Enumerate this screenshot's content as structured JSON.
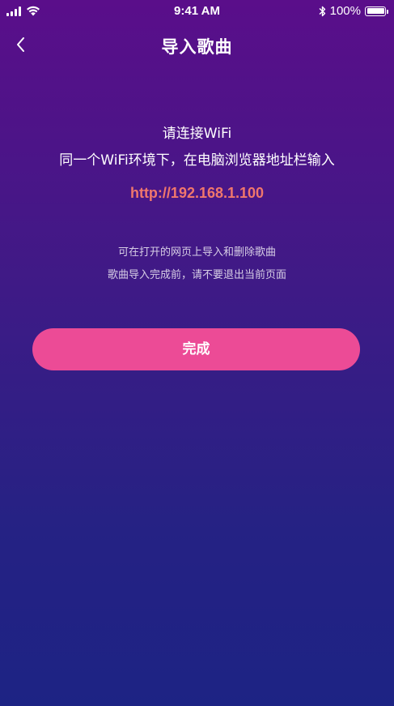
{
  "status_bar": {
    "time": "9:41 AM",
    "battery_text": "100%",
    "battery_level": 1.0,
    "icons": [
      "signal-icon",
      "wifi-icon",
      "bluetooth-icon",
      "battery-icon"
    ]
  },
  "nav": {
    "title": "导入歌曲",
    "back_icon": "chevron-left-icon"
  },
  "instructions": {
    "line1": "请连接WiFi",
    "line2": "同一个WiFi环境下，在电脑浏览器地址栏输入",
    "url": "http://192.168.1.100"
  },
  "notes": {
    "line1": "可在打开的网页上导入和删除歌曲",
    "line2": "歌曲导入完成前，请不要退出当前页面"
  },
  "actions": {
    "done_label": "完成"
  },
  "colors": {
    "background_top": "#5a0e8a",
    "background_bottom": "#1d2384",
    "url": "#f0776c",
    "button": "#ec4b96"
  }
}
